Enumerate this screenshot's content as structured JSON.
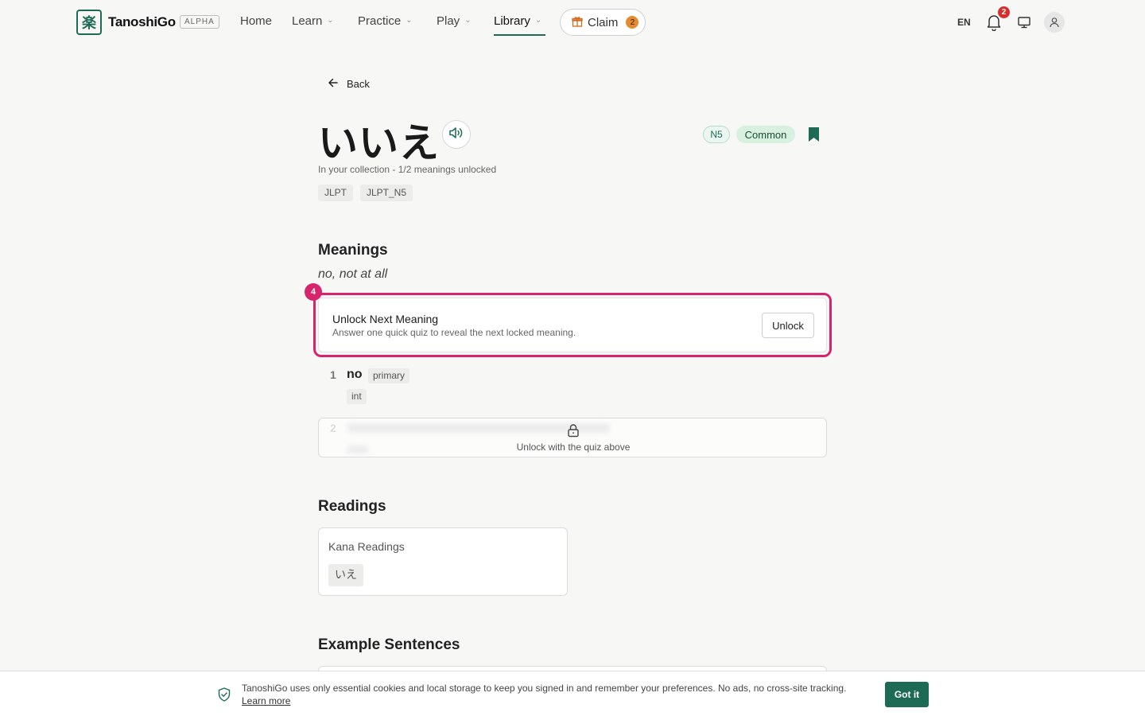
{
  "header": {
    "logo_glyph": "楽",
    "brand": "TanoshiGo",
    "alpha": "ALPHA",
    "nav": {
      "home": "Home",
      "learn": "Learn",
      "practice": "Practice",
      "play": "Play",
      "library": "Library"
    },
    "claim_label": "Claim",
    "claim_count": "2",
    "lang": "EN",
    "notif_count": "2",
    "accent": "#1d6b54"
  },
  "page": {
    "back": "Back",
    "word": "いいえ",
    "level_badge": "N5",
    "common_badge": "Common",
    "collection_status": "In your collection - 1/2 meanings unlocked",
    "tags": [
      "JLPT",
      "JLPT_N5"
    ]
  },
  "meanings": {
    "heading": "Meanings",
    "summary": "no, not at all",
    "step_badge": "4",
    "unlock_card": {
      "title": "Unlock Next Meaning",
      "subtitle": "Answer one quick quiz to reveal the next locked meaning.",
      "button": "Unlock"
    },
    "items": [
      {
        "num": "1",
        "word": "no",
        "badge": "primary",
        "pos": "int"
      },
      {
        "num": "2",
        "locked_text": "Unlock with the quiz above"
      }
    ]
  },
  "readings": {
    "heading": "Readings",
    "kana_label": "Kana Readings",
    "kana": "いえ"
  },
  "examples": {
    "heading": "Example Sentences"
  },
  "cookie": {
    "text": "TanoshiGo uses only essential cookies and local storage to keep you signed in and remember your preferences. No ads, no cross-site tracking.",
    "link": "Learn more",
    "button": "Got it"
  }
}
